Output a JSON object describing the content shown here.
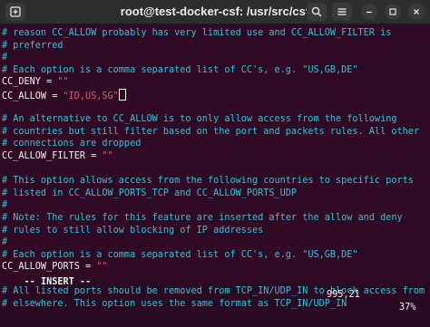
{
  "window": {
    "title": "root@test-docker-csf: /usr/src/csf"
  },
  "toolbar": {
    "new_tab_icon": "new-tab-icon",
    "search_icon": "search-icon",
    "menu_icon": "hamburger-menu-icon",
    "minimize_icon": "minimize-icon",
    "maximize_icon": "maximize-icon",
    "close_icon": "close-icon"
  },
  "editor": {
    "lines": [
      {
        "text": "# reason CC_ALLOW probably has very limited use and CC_ALLOW_FILTER is",
        "type": "comment"
      },
      {
        "text": "# preferred",
        "type": "comment"
      },
      {
        "text": "#",
        "type": "comment"
      },
      {
        "text": "# Each option is a comma separated list of CC's, e.g. \"US,GB,DE\"",
        "type": "comment"
      },
      {
        "key": "CC_DENY = ",
        "value": "\"\"",
        "type": "setting"
      },
      {
        "key": "CC_ALLOW = ",
        "value": "\"ID,US,SG\"",
        "type": "setting",
        "cursor": true
      },
      {
        "text": "",
        "type": "blank"
      },
      {
        "text": "# An alternative to CC_ALLOW is to only allow access from the following",
        "type": "comment"
      },
      {
        "text": "# countries but still filter based on the port and packets rules. All other",
        "type": "comment"
      },
      {
        "text": "# connections are dropped",
        "type": "comment"
      },
      {
        "key": "CC_ALLOW_FILTER = ",
        "value": "\"\"",
        "type": "setting"
      },
      {
        "text": "",
        "type": "blank"
      },
      {
        "text": "# This option allows access from the following countries to specific ports",
        "type": "comment"
      },
      {
        "text": "# listed in CC_ALLOW_PORTS_TCP and CC_ALLOW_PORTS_UDP",
        "type": "comment"
      },
      {
        "text": "#",
        "type": "comment"
      },
      {
        "text": "# Note: The rules for this feature are inserted after the allow and deny",
        "type": "comment"
      },
      {
        "text": "# rules to still allow blocking of IP addresses",
        "type": "comment"
      },
      {
        "text": "#",
        "type": "comment"
      },
      {
        "text": "# Each option is a comma separated list of CC's, e.g. \"US,GB,DE\"",
        "type": "comment"
      },
      {
        "key": "CC_ALLOW_PORTS = ",
        "value": "\"\"",
        "type": "setting"
      },
      {
        "text": "",
        "type": "blank"
      },
      {
        "text": "# All listed ports should be removed from TCP_IN/UDP_IN to block access from",
        "type": "comment"
      },
      {
        "text": "# elsewhere. This option uses the same format as TCP_IN/UDP_IN",
        "type": "comment"
      }
    ]
  },
  "status_bar": {
    "mode": "-- INSERT --",
    "position": "995,21",
    "percent": "37%"
  },
  "colors": {
    "background": "#300a24",
    "comment": "#34c2d6",
    "string": "#e5577a",
    "text": "#f2f2f2",
    "titlebar": "#2d2d2d"
  }
}
